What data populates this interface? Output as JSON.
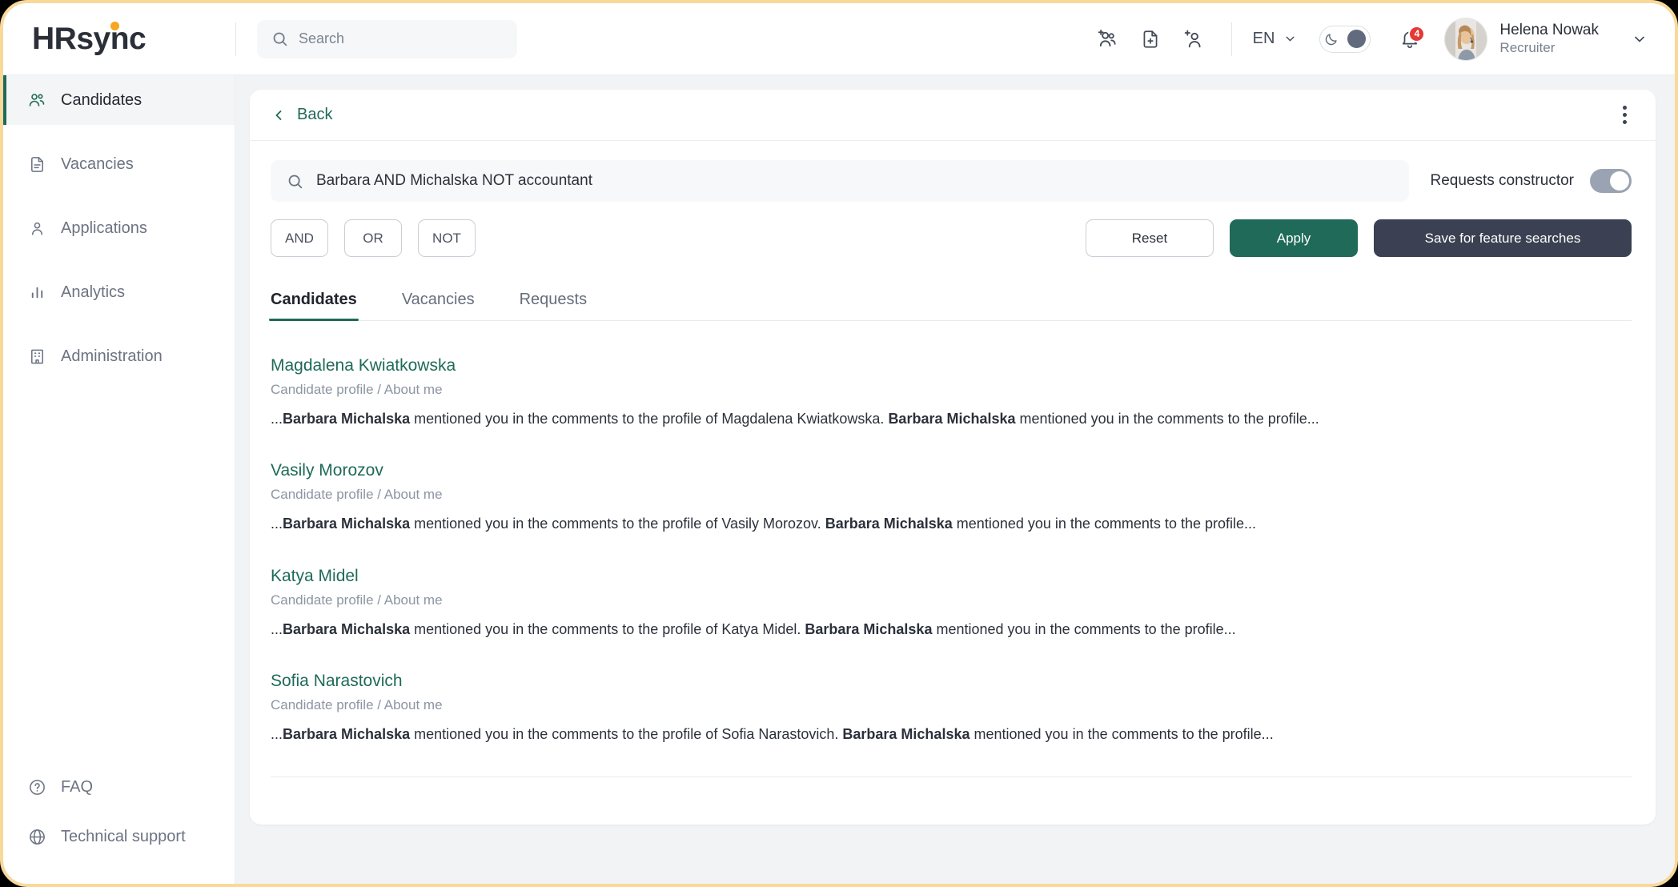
{
  "brand": {
    "name": "HRsync",
    "accent_green": "#1f6a58",
    "accent_orange": "#f5a623",
    "dark": "#3b4152"
  },
  "header": {
    "search_placeholder": "Search",
    "search_value": "",
    "icons": [
      "add-group-icon",
      "add-document-icon",
      "add-user-icon"
    ],
    "language": "EN",
    "dark_mode_label": "moon-icon",
    "notifications_count": "4",
    "user": {
      "name": "Helena Nowak",
      "role": "Recruiter"
    }
  },
  "sidebar": {
    "items": [
      {
        "label": "Candidates",
        "icon": "people-icon",
        "active": true
      },
      {
        "label": "Vacancies",
        "icon": "document-icon",
        "active": false
      },
      {
        "label": "Applications",
        "icon": "user-icon",
        "active": false
      },
      {
        "label": "Analytics",
        "icon": "bar-chart-icon",
        "active": false
      },
      {
        "label": "Administration",
        "icon": "building-icon",
        "active": false
      }
    ],
    "bottom_items": [
      {
        "label": "FAQ",
        "icon": "help-circle-icon"
      },
      {
        "label": "Technical support",
        "icon": "globe-icon"
      }
    ]
  },
  "card": {
    "back_label": "Back",
    "menu_icon": "kebab-menu-icon",
    "query_value": "Barbara AND Michalska NOT accountant",
    "query_placeholder": "Search",
    "requests_constructor_label": "Requests constructor",
    "requests_constructor_on": true,
    "operators": [
      "AND",
      "OR",
      "NOT"
    ],
    "actions": {
      "reset": "Reset",
      "apply": "Apply",
      "save": "Save for feature searches"
    },
    "tabs": [
      {
        "label": "Candidates",
        "active": true
      },
      {
        "label": "Vacancies",
        "active": false
      },
      {
        "label": "Requests",
        "active": false
      }
    ],
    "results": [
      {
        "name": "Magdalena Kwiatkowska",
        "path": "Candidate profile / About me",
        "snippet_pre": "...",
        "snippet_hl1": "Barbara Michalska",
        "snippet_mid": " mentioned you in the comments to the profile of Magdalena Kwiatkowska. ",
        "snippet_hl2": "Barbara Michalska",
        "snippet_post": " mentioned you in the comments to the profile..."
      },
      {
        "name": "Vasily Morozov",
        "path": "Candidate profile / About me",
        "snippet_pre": "...",
        "snippet_hl1": "Barbara Michalska",
        "snippet_mid": " mentioned you in the comments to the profile of Vasily Morozov. ",
        "snippet_hl2": "Barbara Michalska",
        "snippet_post": " mentioned you in the comments to the profile..."
      },
      {
        "name": "Katya Midel",
        "path": "Candidate profile / About me",
        "snippet_pre": "...",
        "snippet_hl1": "Barbara Michalska",
        "snippet_mid": " mentioned you in the comments to the profile of Katya Midel. ",
        "snippet_hl2": "Barbara Michalska",
        "snippet_post": " mentioned you in the comments to the profile..."
      },
      {
        "name": "Sofia Narastovich",
        "path": "Candidate profile / About me",
        "snippet_pre": "...",
        "snippet_hl1": "Barbara Michalska",
        "snippet_mid": " mentioned you in the comments to the profile of Sofia Narastovich. ",
        "snippet_hl2": "Barbara Michalska",
        "snippet_post": " mentioned you in the comments to the profile..."
      }
    ]
  }
}
